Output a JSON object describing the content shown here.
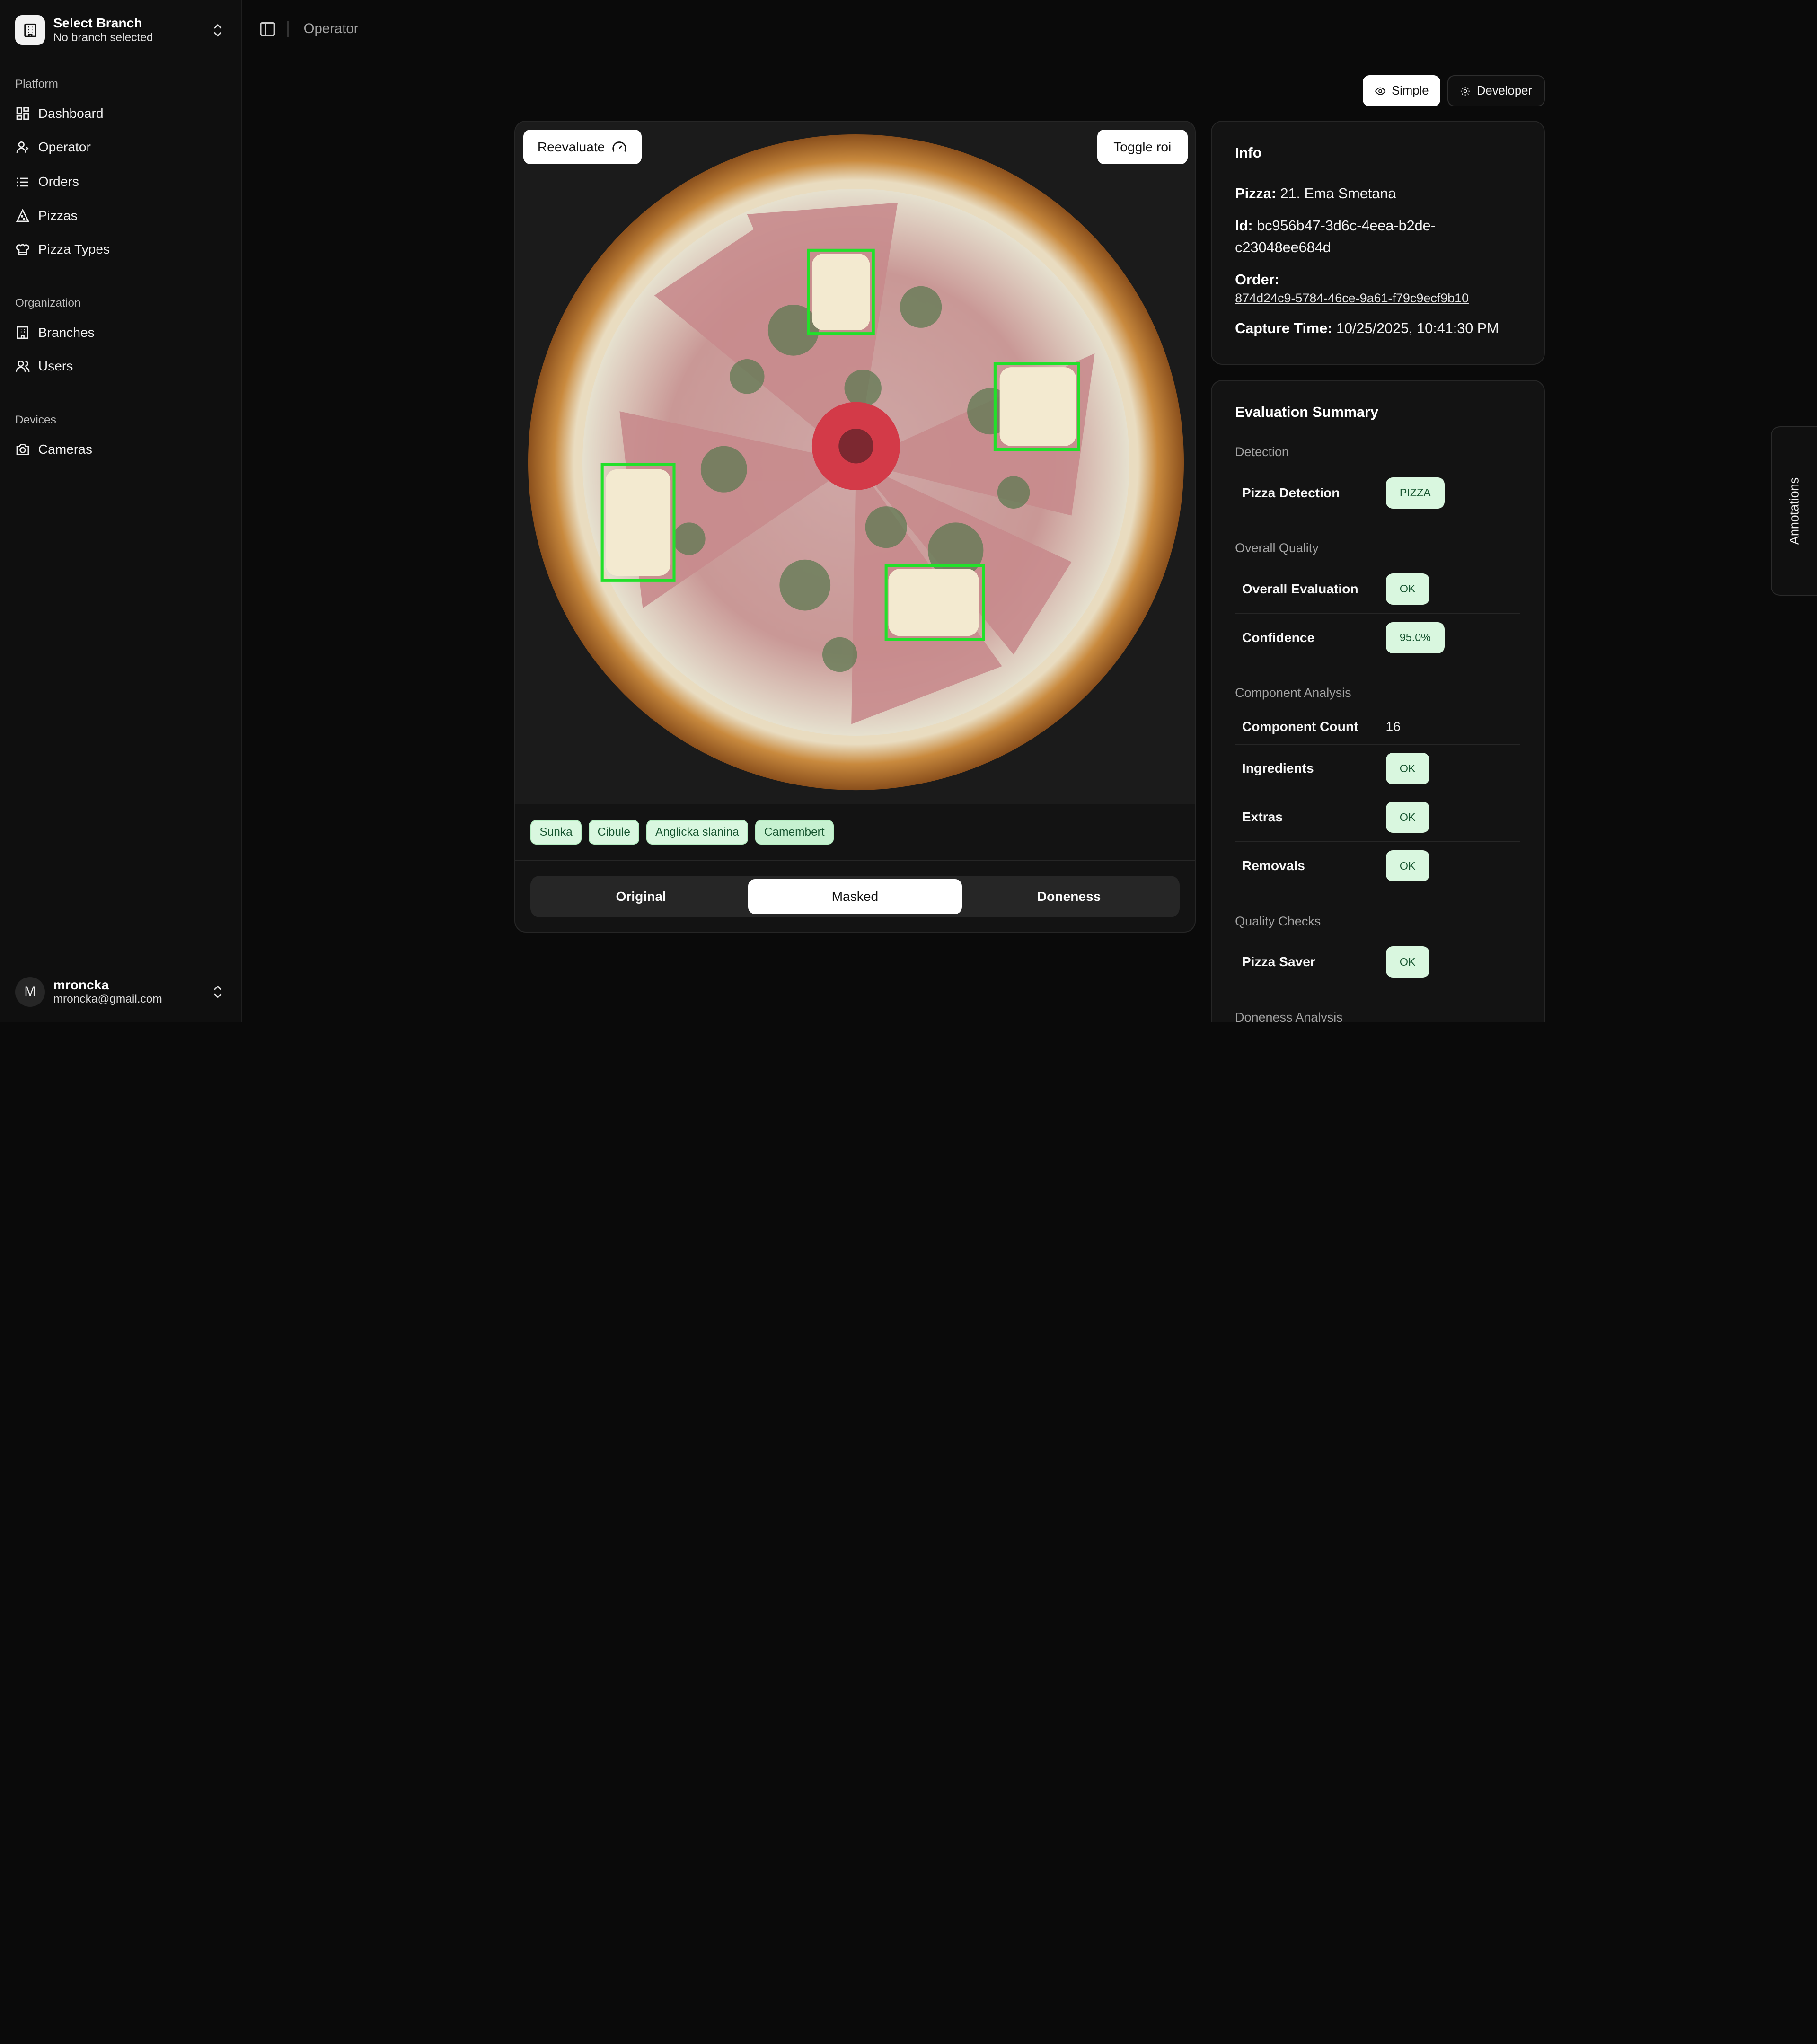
{
  "sidebar": {
    "branch": {
      "title": "Select Branch",
      "subtitle": "No branch selected"
    },
    "groups": [
      {
        "label": "Platform",
        "items": [
          {
            "label": "Dashboard",
            "icon": "dashboard-icon"
          },
          {
            "label": "Operator",
            "icon": "operator-icon"
          },
          {
            "label": "Orders",
            "icon": "list-icon"
          },
          {
            "label": "Pizzas",
            "icon": "pizza-icon"
          },
          {
            "label": "Pizza Types",
            "icon": "chef-hat-icon"
          }
        ]
      },
      {
        "label": "Organization",
        "items": [
          {
            "label": "Branches",
            "icon": "building-icon"
          },
          {
            "label": "Users",
            "icon": "users-icon"
          }
        ]
      },
      {
        "label": "Devices",
        "items": [
          {
            "label": "Cameras",
            "icon": "camera-icon"
          }
        ]
      }
    ],
    "user": {
      "initial": "M",
      "name": "mroncka",
      "email": "mroncka@gmail.com"
    }
  },
  "header": {
    "breadcrumb": "Operator"
  },
  "modes": {
    "simple": "Simple",
    "developer": "Developer",
    "active": "simple"
  },
  "image_panel": {
    "reevaluate_label": "Reevaluate",
    "toggle_roi_label": "Toggle roi",
    "ingredients": [
      "Sunka",
      "Cibule",
      "Anglicka slanina",
      "Camembert"
    ],
    "tabs": [
      "Original",
      "Masked",
      "Doneness"
    ],
    "active_tab": "Masked"
  },
  "info": {
    "title": "Info",
    "pizza_label": "Pizza:",
    "pizza_value": "21. Ema Smetana",
    "id_label": "Id:",
    "id_value": "bc956b47-3d6c-4eea-b2de-c23048ee684d",
    "order_label": "Order:",
    "order_value": "874d24c9-5784-46ce-9a61-f79c9ecf9b10",
    "capture_label": "Capture Time:",
    "capture_value": "10/25/2025, 10:41:30 PM"
  },
  "evaluation": {
    "title": "Evaluation Summary",
    "detection_label": "Detection",
    "pizza_detection_label": "Pizza Detection",
    "pizza_detection_value": "PIZZA",
    "overall_quality_label": "Overall Quality",
    "overall_evaluation_label": "Overall Evaluation",
    "overall_evaluation_value": "OK",
    "confidence_label": "Confidence",
    "confidence_value": "95.0%",
    "component_analysis_label": "Component Analysis",
    "component_count_label": "Component Count",
    "component_count_value": "16",
    "ingredients_label": "Ingredients",
    "ingredients_value": "OK",
    "extras_label": "Extras",
    "extras_value": "OK",
    "removals_label": "Removals",
    "removals_value": "OK",
    "quality_checks_label": "Quality Checks",
    "pizza_saver_label": "Pizza Saver",
    "pizza_saver_value": "OK",
    "doneness_analysis_label": "Doneness Analysis"
  },
  "annotations_tab": "Annotations",
  "colors": {
    "accent": "#ffffff",
    "ok_badge_bg": "#d9f7df",
    "ok_badge_text": "#14532d",
    "roi_box": "#22e02a"
  }
}
